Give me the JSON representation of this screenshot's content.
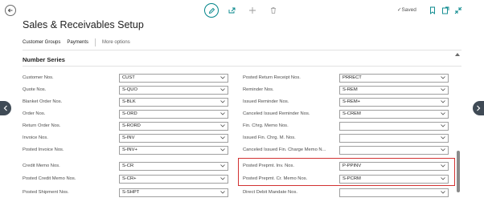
{
  "page": {
    "title": "Sales & Receivables Setup",
    "saved_label": "Saved"
  },
  "actions": {
    "customer_groups": "Customer Groups",
    "payments": "Payments",
    "more_options": "More options"
  },
  "section": {
    "title": "Number Series"
  },
  "left_fields": [
    {
      "label": "Customer Nos.",
      "value": "CUST"
    },
    {
      "label": "Quote Nos.",
      "value": "S-QUO"
    },
    {
      "label": "Blanket Order Nos.",
      "value": "S-BLK"
    },
    {
      "label": "Order Nos.",
      "value": "S-ORD"
    },
    {
      "label": "Return Order Nos.",
      "value": "S-RORD"
    },
    {
      "label": "Invoice Nos.",
      "value": "S-INV"
    },
    {
      "label": "Posted Invoice Nos.",
      "value": "S-INV+"
    },
    {
      "label": "Credit Memo Nos.",
      "value": "S-CR"
    },
    {
      "label": "Posted Credit Memo Nos.",
      "value": "S-CR+"
    },
    {
      "label": "Posted Shipment Nos.",
      "value": "S-SHPT"
    }
  ],
  "right_fields": [
    {
      "label": "Posted Return Receipt Nos.",
      "value": "PRRECT"
    },
    {
      "label": "Reminder Nos.",
      "value": "S-REM"
    },
    {
      "label": "Issued Reminder Nos.",
      "value": "S-REM+"
    },
    {
      "label": "Canceled Issued Reminder Nos.",
      "value": "S-CREM"
    },
    {
      "label": "Fin. Chrg. Memo Nos.",
      "value": ""
    },
    {
      "label": "Issued Fin. Chrg. M. Nos.",
      "value": ""
    },
    {
      "label": "Canceled Issued Fin. Charge Memo N...",
      "value": ""
    },
    {
      "label": "Posted Prepmt. Inv. Nos.",
      "value": "P-PPINV"
    },
    {
      "label": "Posted Prepmt. Cr. Memo Nos.",
      "value": "S-PCRM"
    },
    {
      "label": "Direct Debit Mandate Nos.",
      "value": ""
    }
  ],
  "colors": {
    "accent": "#008489",
    "highlight": "#d23232"
  }
}
